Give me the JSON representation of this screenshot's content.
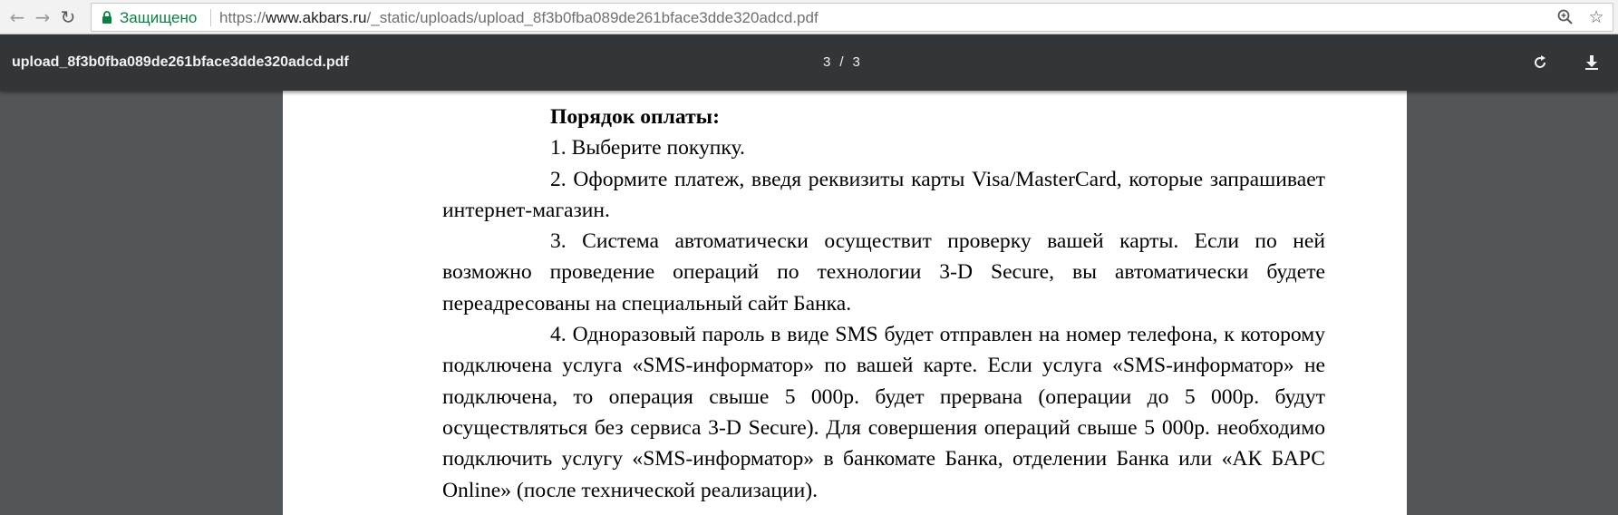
{
  "browser": {
    "secure_label": "Защищено",
    "url_scheme": "https://",
    "url_host": "www.akbars.ru",
    "url_path": "/_static/uploads/upload_8f3b0fba089de261bface3dde320adcd.pdf",
    "icons": [
      "back-arrow-icon",
      "forward-arrow-icon",
      "reload-icon",
      "lock-icon",
      "zoom-icon",
      "star-icon"
    ]
  },
  "pdf_toolbar": {
    "title": "upload_8f3b0fba089de261bface3dde320adcd.pdf",
    "current_page": "3",
    "separator": "/",
    "total_pages": "3",
    "icons": [
      "rotate-icon",
      "download-icon"
    ]
  },
  "document": {
    "heading": "Порядок оплаты:",
    "items": [
      "1. Выберите покупку.",
      "2. Оформите платеж, введя реквизиты карты Visa/MasterCard, которые запрашивает интернет-магазин.",
      "3. Система автоматически осуществит проверку вашей карты. Если по ней возможно проведение операций по технологии 3-D Secure, вы автоматически будете переадресованы на специальный сайт Банка.",
      "4. Одноразовый пароль в виде SMS будет отправлен на номер телефона, к которому подключена услуга «SMS-информатор» по вашей карте. Если услуга «SMS-информатор» не подключена, то операция свыше 5 000р. будет прервана (операции до 5 000р. будут осуществляться без сервиса 3-D Secure). Для совершения операций свыше 5 000р. необходимо подключить услугу «SMS-информатор» в банкомате Банка, отделении Банка или «АК БАРС Online» (после технической реализации)."
    ]
  },
  "colors": {
    "secure_green": "#0b8043",
    "toolbar_bg": "#323639",
    "viewer_bg": "#525659",
    "page_bg": "#ffffff"
  }
}
